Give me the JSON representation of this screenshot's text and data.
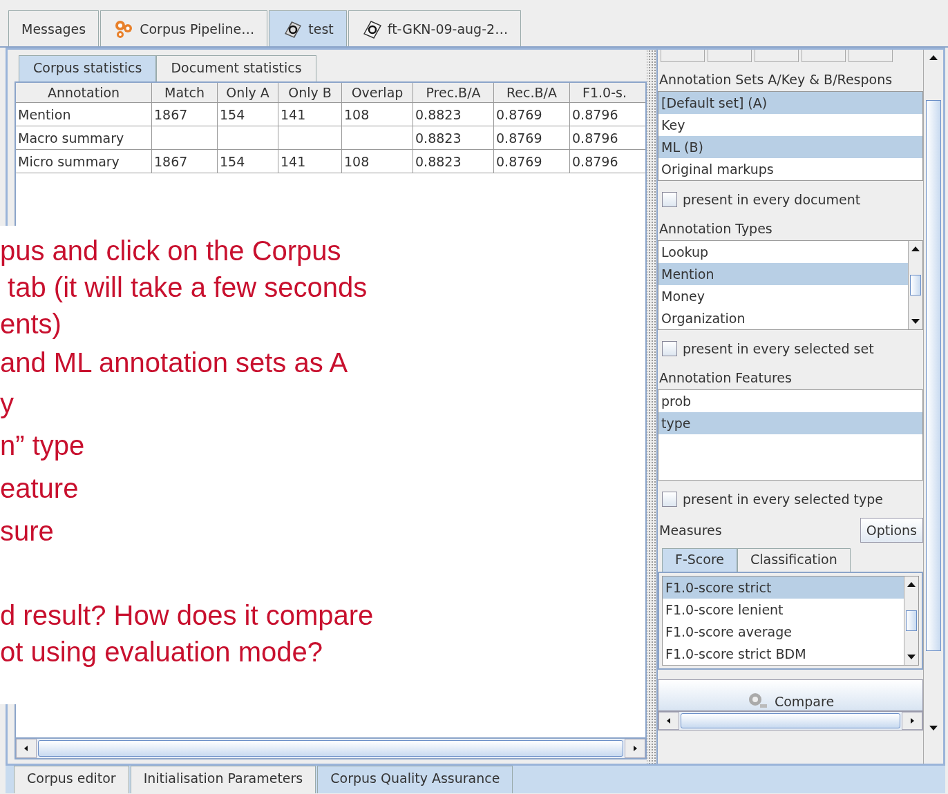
{
  "top_tabs": [
    {
      "label": "Messages",
      "kind": "plain",
      "selected": false
    },
    {
      "label": "Corpus Pipeline…",
      "kind": "pipeline",
      "selected": false
    },
    {
      "label": "test",
      "kind": "corpus",
      "selected": true
    },
    {
      "label": "ft-GKN-09-aug-2…",
      "kind": "document",
      "selected": false
    }
  ],
  "inner_tabs": [
    {
      "label": "Corpus statistics",
      "selected": true
    },
    {
      "label": "Document statistics",
      "selected": false
    }
  ],
  "table": {
    "columns": [
      "Annotation",
      "Match",
      "Only A",
      "Only B",
      "Overlap",
      "Prec.B/A",
      "Rec.B/A",
      "F1.0-s."
    ],
    "rows": [
      [
        "Mention",
        "1867",
        "154",
        "141",
        "108",
        "0.8823",
        "0.8769",
        "0.8796"
      ],
      [
        "Macro summary",
        "",
        "",
        "",
        "",
        "0.8823",
        "0.8769",
        "0.8796"
      ],
      [
        "Micro summary",
        "1867",
        "154",
        "141",
        "108",
        "0.8823",
        "0.8769",
        "0.8796"
      ]
    ]
  },
  "slide_text": {
    "lines": [
      "pus and click on the Corpus",
      " tab (it will take a few seconds",
      "ents)",
      "and ML annotation sets as A",
      "y",
      "n” type",
      "eature",
      "sure",
      "d result? How does it compare",
      "ot using evaluation mode?"
    ]
  },
  "right_panel": {
    "sets_label": "Annotation Sets A/Key & B/Respons",
    "sets": [
      {
        "label": "[Default set] (A)",
        "selected": true
      },
      {
        "label": "Key",
        "selected": false
      },
      {
        "label": "ML (B)",
        "selected": true
      },
      {
        "label": "Original markups",
        "selected": false
      }
    ],
    "sets_check": {
      "label": "present in every document",
      "checked": false
    },
    "types_label": "Annotation Types",
    "types": [
      {
        "label": "Lookup",
        "selected": false
      },
      {
        "label": "Mention",
        "selected": true
      },
      {
        "label": "Money",
        "selected": false
      },
      {
        "label": "Organization",
        "selected": false
      }
    ],
    "types_check": {
      "label": "present in every selected set",
      "checked": false
    },
    "features_label": "Annotation Features",
    "features": [
      {
        "label": "prob",
        "selected": false
      },
      {
        "label": "type",
        "selected": true
      }
    ],
    "features_check": {
      "label": "present in every selected type",
      "checked": false
    },
    "measures_label": "Measures",
    "options_button": "Options",
    "measure_tabs": [
      {
        "label": "F-Score",
        "selected": true
      },
      {
        "label": "Classification",
        "selected": false
      }
    ],
    "measures": [
      {
        "label": "F1.0-score strict",
        "selected": true
      },
      {
        "label": "F1.0-score lenient",
        "selected": false
      },
      {
        "label": "F1.0-score average",
        "selected": false
      },
      {
        "label": "F1.0-score strict BDM",
        "selected": false
      }
    ],
    "compare_button": "Compare"
  },
  "bottom_tabs": [
    {
      "label": "Corpus editor",
      "selected": false
    },
    {
      "label": "Initialisation Parameters",
      "selected": false
    },
    {
      "label": "Corpus Quality Assurance",
      "selected": true
    }
  ]
}
